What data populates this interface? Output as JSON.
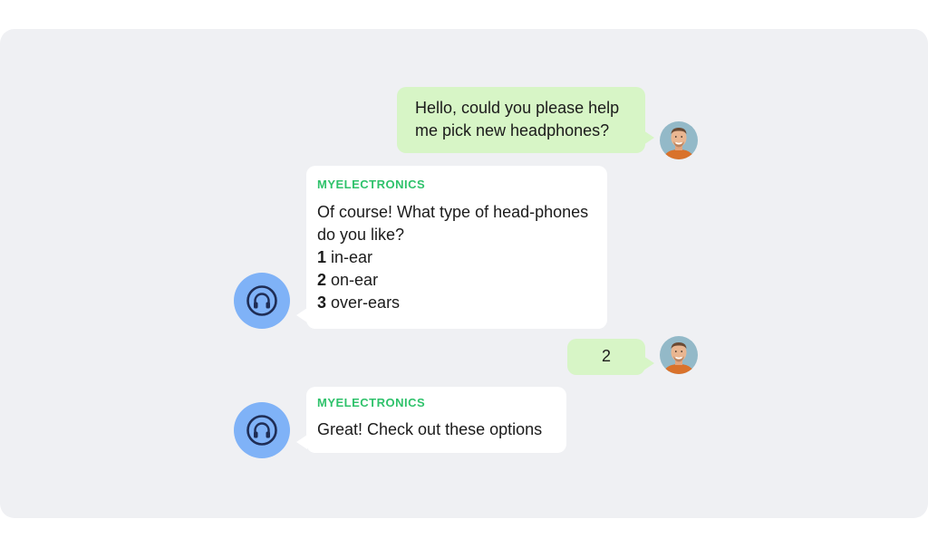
{
  "colors": {
    "panel_bg": "#eff0f3",
    "user_bubble": "#d7f5c6",
    "bot_bubble": "#ffffff",
    "brand_green": "#2fc26b",
    "bot_avatar_bg": "#7fb2f7",
    "bot_icon": "#1f2d55"
  },
  "conversation": {
    "messages": [
      {
        "role": "user",
        "avatar_icon": "user-avatar-icon",
        "lines": [
          "Hello, could you please help",
          "me pick new headphones?"
        ]
      },
      {
        "role": "bot",
        "sender": "MYELECTRONICS",
        "avatar_icon": "headphones-icon",
        "lines": [
          "Of course! What type of head-phones",
          "do you like?"
        ],
        "options": [
          {
            "num": "1",
            "label": "in-ear"
          },
          {
            "num": "2",
            "label": "on-ear"
          },
          {
            "num": "3",
            "label": "over-ears"
          }
        ]
      },
      {
        "role": "user",
        "avatar_icon": "user-avatar-icon",
        "lines": [
          "2"
        ]
      },
      {
        "role": "bot",
        "sender": "MYELECTRONICS",
        "avatar_icon": "headphones-icon",
        "lines": [
          "Great! Check out these options"
        ]
      }
    ]
  }
}
